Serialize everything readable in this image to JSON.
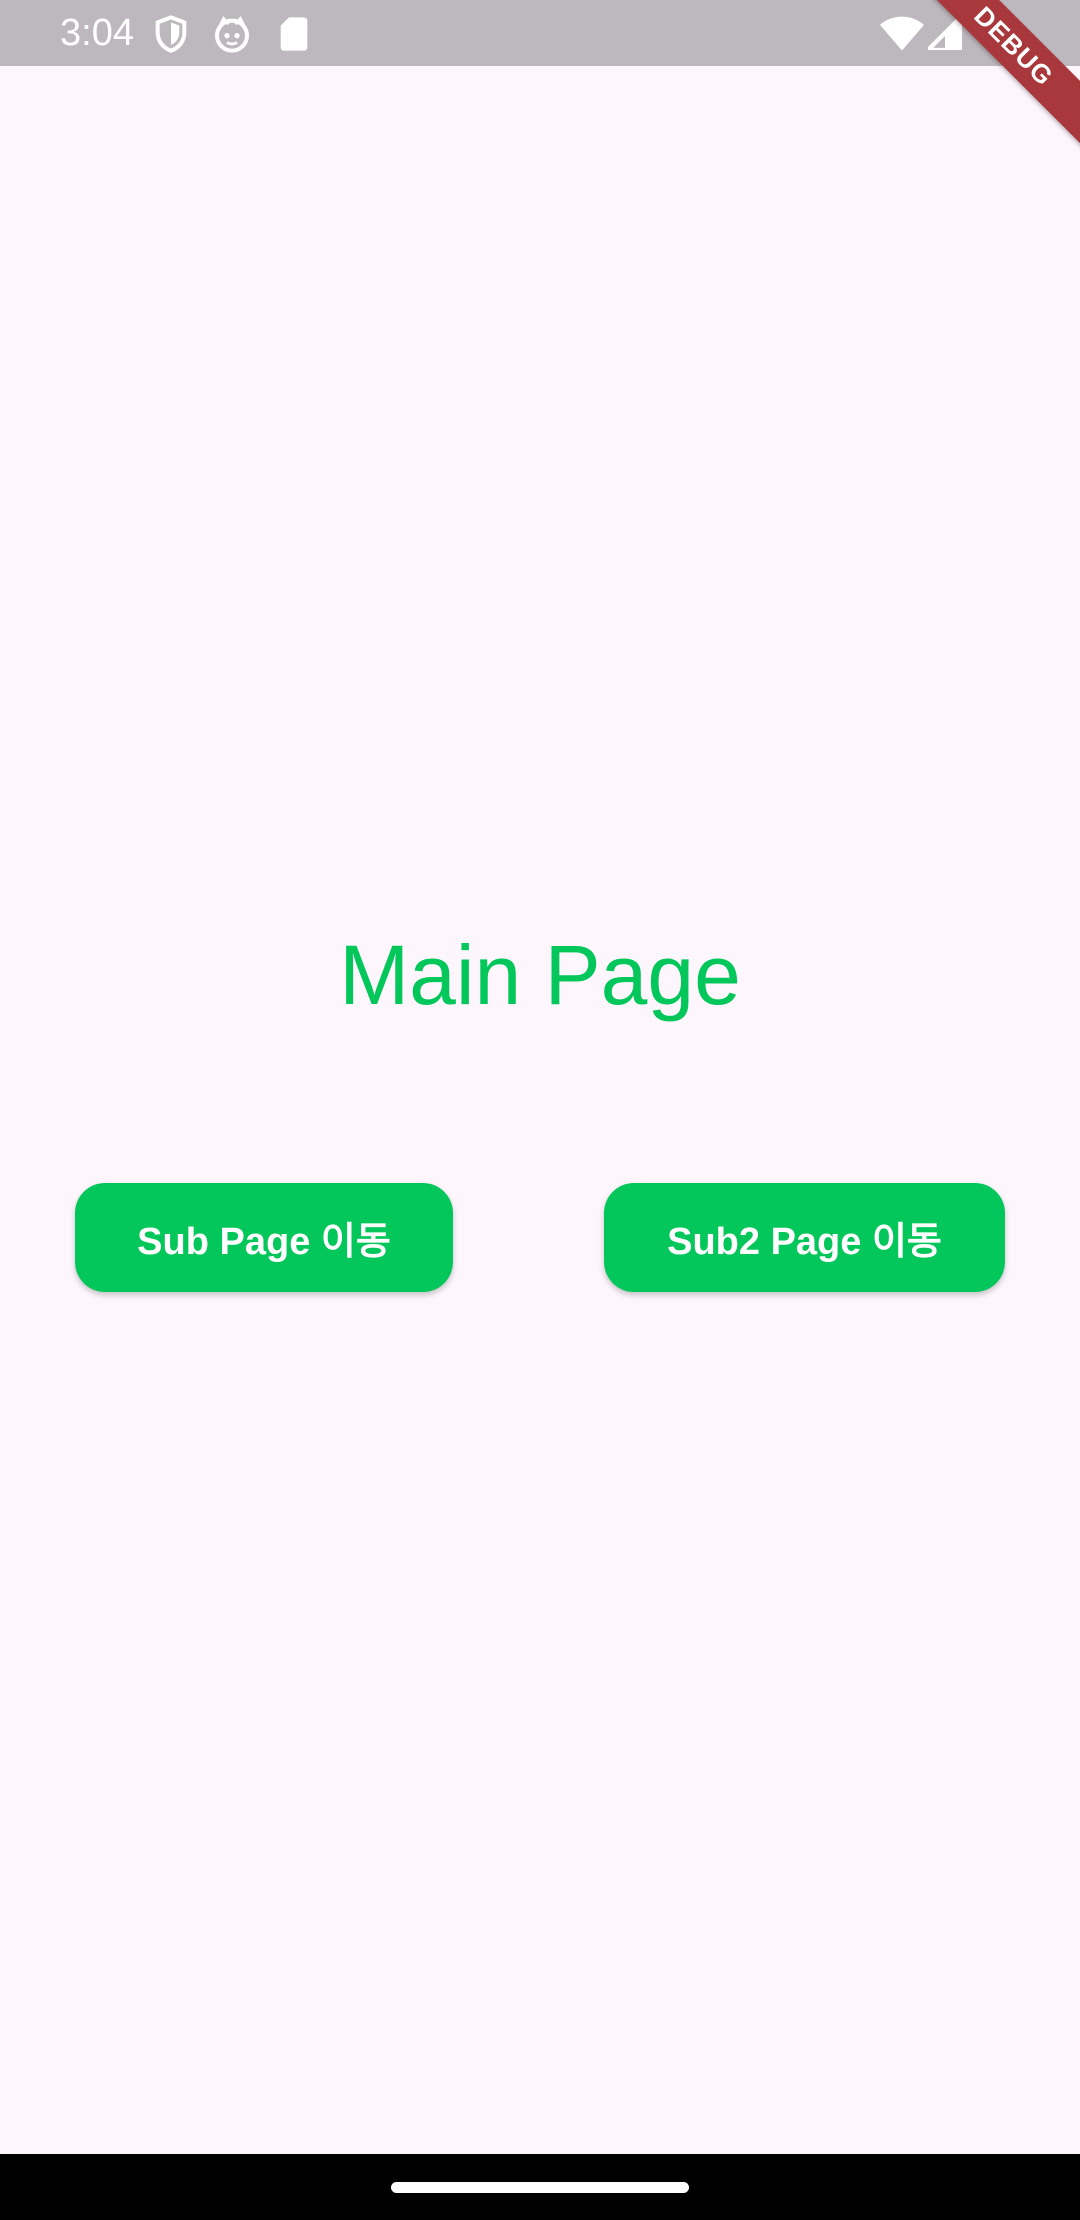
{
  "status_bar": {
    "time": "3:04",
    "icons_left": [
      "shield-icon",
      "cat-face-icon",
      "sd-card-icon"
    ],
    "icons_right": [
      "wifi-icon",
      "signal-icon"
    ]
  },
  "debug_banner": {
    "label": "DEBUG"
  },
  "main": {
    "title": "Main Page",
    "buttons": [
      {
        "label": "Sub Page 이동"
      },
      {
        "label": "Sub2 Page 이동"
      }
    ]
  },
  "colors": {
    "accent": "#03C75A",
    "background": "#FDF7FD",
    "status_bar": "#BDB8BD",
    "debug_banner": "#A8383B"
  }
}
